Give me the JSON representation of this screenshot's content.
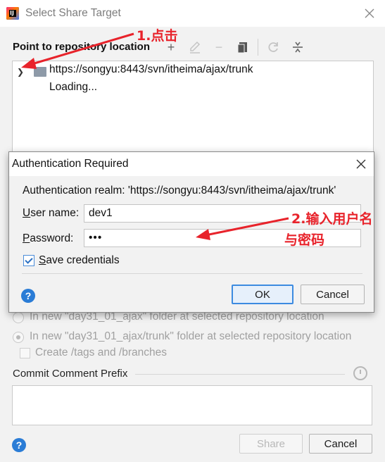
{
  "outer": {
    "title": "Select Share Target",
    "section_label": "Point to repository location",
    "repo_url": "https://songyu:8443/svn/itheima/ajax/trunk",
    "loading": "Loading...",
    "options": [
      "In new \"day31_01_ajax\" folder at selected repository location",
      "In new \"day31_01_ajax/trunk\" folder at selected repository location"
    ],
    "create_tags": "Create /tags and /branches",
    "comment_label": "Commit Comment Prefix",
    "share_button": "Share",
    "cancel_button": "Cancel",
    "help": "?"
  },
  "auth": {
    "title": "Authentication Required",
    "realm": "Authentication realm: 'https://songyu:8443/svn/itheima/ajax/trunk'",
    "username_label_u": "U",
    "username_label_rest": "ser name:",
    "username_value": "dev1",
    "password_label_u": "P",
    "password_label_rest": "assword:",
    "password_value": "•••",
    "save_label_u": "S",
    "save_label_rest": "ave credentials",
    "ok_button": "OK",
    "cancel_button": "Cancel",
    "help": "?"
  },
  "annotations": {
    "step1": "1.点击",
    "step2_line1": "2.输入用户名",
    "step2_line2": "与密码"
  },
  "colors": {
    "annotation": "#e8232b",
    "accent": "#3c8be0"
  }
}
